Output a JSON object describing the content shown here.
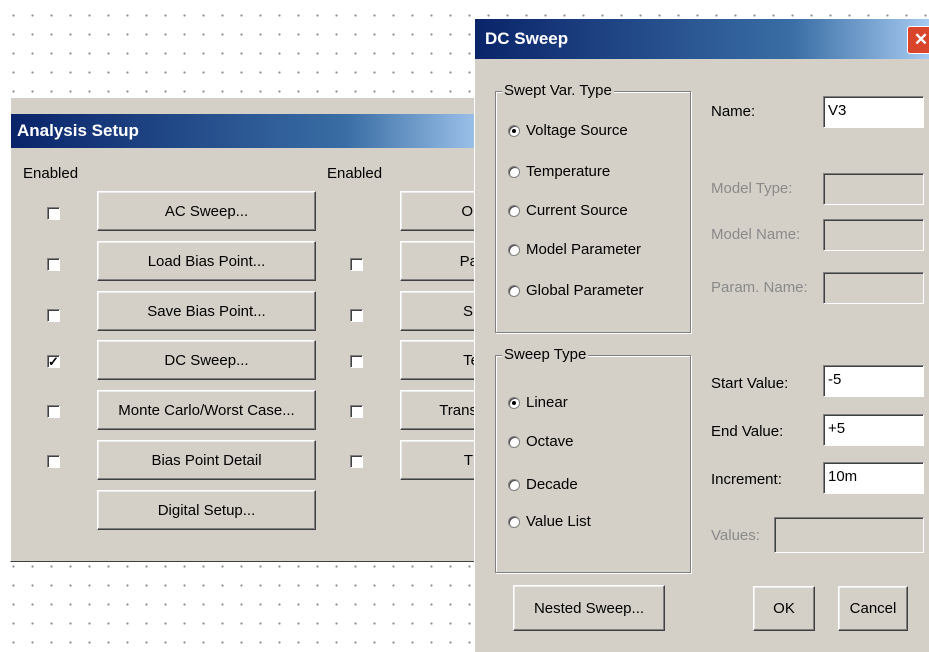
{
  "analysis_setup": {
    "title": "Analysis Setup",
    "enabled_header_left": "Enabled",
    "enabled_header_right": "Enabled",
    "left_rows": [
      {
        "label": "AC Sweep...",
        "checked": false,
        "check_mark": ""
      },
      {
        "label": "Load Bias Point...",
        "checked": false,
        "check_mark": ""
      },
      {
        "label": "Save Bias Point...",
        "checked": false,
        "check_mark": ""
      },
      {
        "label": "DC Sweep...",
        "checked": true,
        "check_mark": "✓"
      },
      {
        "label": "Monte Carlo/Worst Case...",
        "checked": false,
        "check_mark": ""
      },
      {
        "label": "Bias Point Detail",
        "checked": false,
        "check_mark": ""
      }
    ],
    "digital_setup_label": "Digital Setup...",
    "right_rows": [
      {
        "label": "O",
        "checked": null
      },
      {
        "label": "Pa",
        "checked": false
      },
      {
        "label": "S",
        "checked": false
      },
      {
        "label": "Te",
        "checked": false
      },
      {
        "label": "Trans",
        "checked": false
      },
      {
        "label": "T",
        "checked": false
      }
    ]
  },
  "dc_sweep": {
    "title": "DC Sweep",
    "close_glyph": "✕",
    "swept_var": {
      "title": "Swept Var. Type",
      "options": [
        {
          "label": "Voltage Source",
          "selected": true
        },
        {
          "label": "Temperature",
          "selected": false
        },
        {
          "label": "Current Source",
          "selected": false
        },
        {
          "label": "Model Parameter",
          "selected": false
        },
        {
          "label": "Global Parameter",
          "selected": false
        }
      ]
    },
    "name_label": "Name:",
    "name_value": "V3",
    "model_type_label": "Model Type:",
    "model_type_value": "",
    "model_name_label": "Model Name:",
    "model_name_value": "",
    "param_name_label": "Param. Name:",
    "param_name_value": "",
    "sweep_type": {
      "title": "Sweep Type",
      "options": [
        {
          "label": "Linear",
          "selected": true
        },
        {
          "label": "Octave",
          "selected": false
        },
        {
          "label": "Decade",
          "selected": false
        },
        {
          "label": "Value List",
          "selected": false
        }
      ]
    },
    "start_label": "Start Value:",
    "start_value": "-5",
    "end_label": "End Value:",
    "end_value": "+5",
    "increment_label": "Increment:",
    "increment_value": "10m",
    "values_label": "Values:",
    "values_value": "",
    "nested_label": "Nested Sweep...",
    "ok_label": "OK",
    "cancel_label": "Cancel"
  }
}
